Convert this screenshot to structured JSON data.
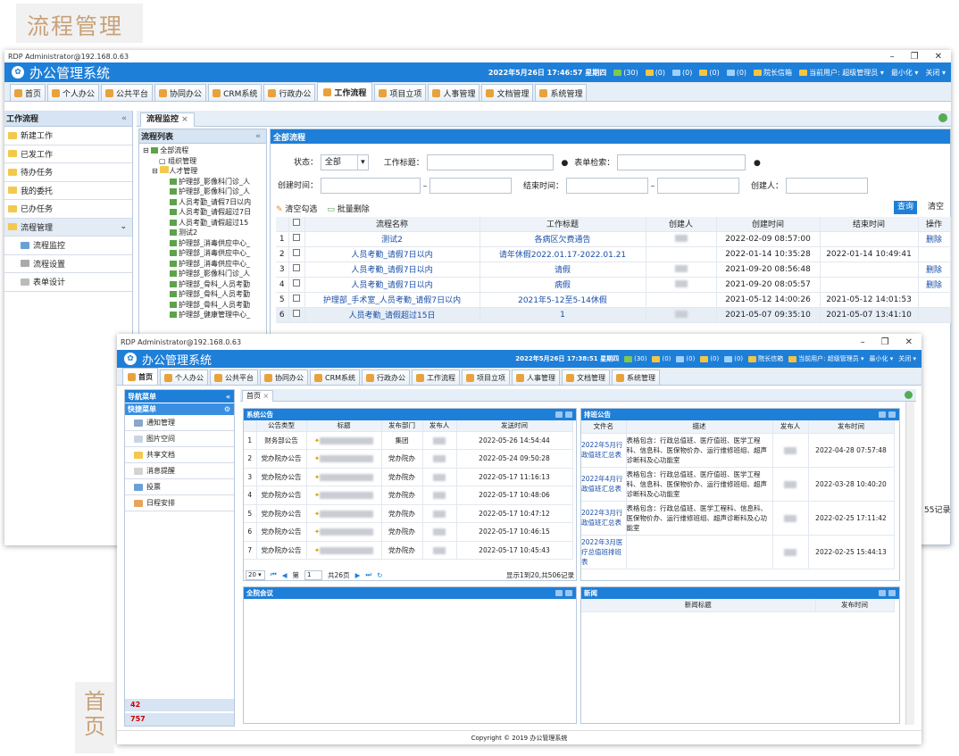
{
  "tags": {
    "top": "流程管理",
    "side1": "首",
    "side2": "页"
  },
  "back": {
    "win_title": "RDP  Administrator@192.168.0.63",
    "app_title": "办公管理系统",
    "datetime": "2022年5月26日 17:46:57 星期四",
    "counters": [
      "(30)",
      "(0)",
      "(0)",
      "(0)",
      "(0)"
    ],
    "leader_mailbox": "院长信箱",
    "current_user": "当前用户: 超级管理员",
    "minimize": "最小化",
    "close": "关闭",
    "nav": [
      "首页",
      "个人办公",
      "公共平台",
      "协同办公",
      "CRM系统",
      "行政办公",
      "工作流程",
      "项目立项",
      "人事管理",
      "文档管理",
      "系统管理"
    ],
    "left_head": "工作流程",
    "left_items": [
      "新建工作",
      "已发工作",
      "待办任务",
      "我的委托",
      "已办任务",
      "流程管理"
    ],
    "left_sub": [
      "流程监控",
      "流程设置",
      "表单设计"
    ],
    "tab": "流程监控",
    "flow_list": "流程列表",
    "tree": [
      "全部流程",
      "组织管理",
      "人才管理",
      "护理部_影像科门诊_人",
      "护理部_影像科门诊_人",
      "人员考勤_请假7日以内",
      "人员考勤_请假超过7日",
      "人员考勤_请假超过15",
      "测试2",
      "护理部_消毒供应中心_",
      "护理部_消毒供应中心_",
      "护理部_消毒供应中心_",
      "护理部_影像科门诊_人",
      "护理部_骨科_人员考勤",
      "护理部_骨科_人员考勤",
      "护理部_骨科_人员考勤",
      "护理部_健康管理中心_"
    ],
    "all_flow": "全部流程",
    "status_label": "状态：",
    "status_value": "全部",
    "work_title_label": "工作标题：",
    "form_search_label": "表单检索：",
    "create_time_label": "创建时间：",
    "end_time_label": "结束时间：",
    "creator_label": "创建人：",
    "clear_check": "清空勾选",
    "batch_delete": "批量删除",
    "query": "查询",
    "clear": "清空",
    "cols": [
      "流程名称",
      "工作标题",
      "创建人",
      "创建时间",
      "结束时间",
      "操作"
    ],
    "rows": [
      {
        "n": "1",
        "name": "测试2",
        "title": "各病区欠费通告",
        "ct": "2022-02-09 08:57:00",
        "et": "",
        "op": "删除"
      },
      {
        "n": "2",
        "name": "人员考勤_请假7日以内",
        "title": "请年休假2022.01.17-2022.01.21",
        "ct": "2022-01-14 10:35:28",
        "et": "2022-01-14 10:49:41",
        "op": ""
      },
      {
        "n": "3",
        "name": "人员考勤_请假7日以内",
        "title": "请假",
        "ct": "2021-09-20 08:56:48",
        "et": "",
        "op": "删除"
      },
      {
        "n": "4",
        "name": "人员考勤_请假7日以内",
        "title": "病假",
        "ct": "2021-09-20 08:05:57",
        "et": "",
        "op": "删除"
      },
      {
        "n": "5",
        "name": "护理部_手术室_人员考勤_请假7日以内",
        "title": "2021年5-12至5-14休假",
        "ct": "2021-05-12 14:00:26",
        "et": "2021-05-12 14:01:53",
        "op": ""
      },
      {
        "n": "6",
        "name": "人员考勤_请假超过15日",
        "title": "1",
        "ct": "2021-05-07 09:35:10",
        "et": "2021-05-07 13:41:10",
        "op": ""
      }
    ],
    "records": "55记录"
  },
  "front": {
    "win_title": "RDP  Administrator@192.168.0.63",
    "app_title": "办公管理系统",
    "datetime": "2022年5月26日 17:38:51 星期四",
    "counters": [
      "(30)",
      "(0)",
      "(0)",
      "(0)",
      "(0)"
    ],
    "leader_mailbox": "院长信箱",
    "current_user": "当前用户: 超级管理员",
    "minimize": "最小化",
    "close": "关闭",
    "nav": [
      "首页",
      "个人办公",
      "公共平台",
      "协同办公",
      "CRM系统",
      "行政办公",
      "工作流程",
      "项目立项",
      "人事管理",
      "文档管理",
      "系统管理"
    ],
    "nav_menu": "导航菜单",
    "quick_menu": "快捷菜单",
    "quick_items": [
      "通知管理",
      "图片空间",
      "共享文档",
      "消息提醒",
      "投票",
      "日程安排"
    ],
    "online": "42",
    "total": "757",
    "tab": "首页",
    "notice_title": "系统公告",
    "notice_cols": [
      "公告类型",
      "标题",
      "发布部门",
      "发布人",
      "发送时间"
    ],
    "notices": [
      {
        "n": "1",
        "type": "财务部公告",
        "dept": "集团",
        "time": "2022-05-26 14:54:44"
      },
      {
        "n": "2",
        "type": "党办院办公告",
        "dept": "党办院办",
        "time": "2022-05-24 09:50:28"
      },
      {
        "n": "3",
        "type": "党办院办公告",
        "dept": "党办院办",
        "time": "2022-05-17 11:16:13"
      },
      {
        "n": "4",
        "type": "党办院办公告",
        "dept": "党办院办",
        "time": "2022-05-17 10:48:06"
      },
      {
        "n": "5",
        "type": "党办院办公告",
        "dept": "党办院办",
        "time": "2022-05-17 10:47:12"
      },
      {
        "n": "6",
        "type": "党办院办公告",
        "dept": "党办院办",
        "time": "2022-05-17 10:46:15"
      },
      {
        "n": "7",
        "type": "党办院办公告",
        "dept": "党办院办",
        "time": "2022-05-17 10:45:43"
      }
    ],
    "pager": {
      "size": "20",
      "page_label": "第",
      "page": "1",
      "total": "共26页",
      "info": "显示1到20,共506记录"
    },
    "duty_title": "排班公告",
    "duty_cols": [
      "文件名",
      "描述",
      "发布人",
      "发布时间"
    ],
    "duties": [
      {
        "file": "2022年5月行政值班汇总表",
        "desc": "表格包含：行政总值班、医疗值班、医学工程科、信息科、医保物价办、运行维修班组、超声诊断科及心功能室",
        "time": "2022-04-28 07:57:48"
      },
      {
        "file": "2022年4月行政值班汇总表",
        "desc": "表格包含：行政总值班、医疗值班、医学工程科、信息科、医保物价办、运行维修班组、超声诊断科及心功能室",
        "time": "2022-03-28 10:40:20"
      },
      {
        "file": "2022年3月行政值班汇总表",
        "desc": "表格包含：行政总值班、医学工程科、信息科、医保物价办、运行维修班组、超声诊断科及心功能室",
        "time": "2022-02-25 17:11:42"
      },
      {
        "file": "2022年3月医疗总值班排班表",
        "desc": "",
        "time": "2022-02-25 15:44:13"
      }
    ],
    "meeting_title": "全院会议",
    "news_title": "新闻",
    "news_cols": [
      "新闻标题",
      "发布时间"
    ],
    "copyright": "Copyright © 2019 办公管理系统"
  }
}
